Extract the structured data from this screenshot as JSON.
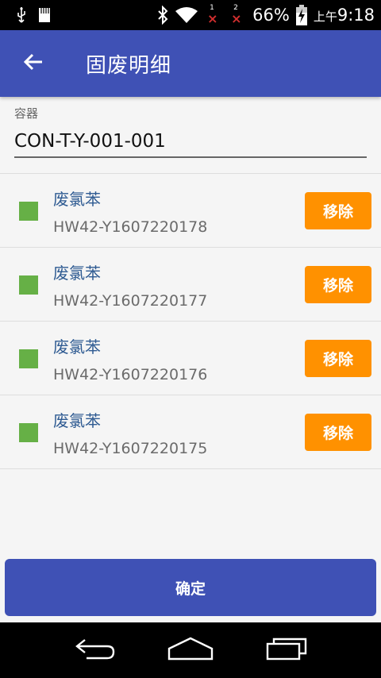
{
  "status_bar": {
    "sim1": "1",
    "sim2": "2",
    "battery": "66%",
    "ampm": "上午",
    "time": "9:18"
  },
  "app_bar": {
    "title": "固废明细"
  },
  "container": {
    "label": "容器",
    "value": "CON-T-Y-001-001"
  },
  "items": [
    {
      "name": "废氯苯",
      "code": "HW42-Y1607220178",
      "action": "移除"
    },
    {
      "name": "废氯苯",
      "code": "HW42-Y1607220177",
      "action": "移除"
    },
    {
      "name": "废氯苯",
      "code": "HW42-Y1607220176",
      "action": "移除"
    },
    {
      "name": "废氯苯",
      "code": "HW42-Y1607220175",
      "action": "移除"
    }
  ],
  "confirm_label": "确定",
  "colors": {
    "primary": "#3f51b5",
    "accent": "#ff9100",
    "swatch": "#66b046"
  }
}
